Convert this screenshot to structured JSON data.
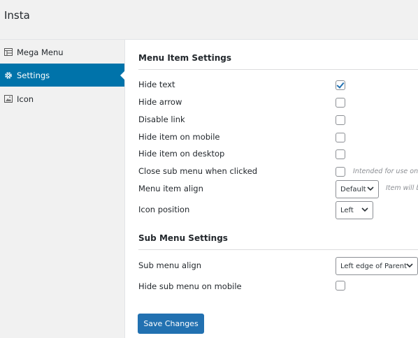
{
  "header": {
    "title": "Insta"
  },
  "sidebar": {
    "items": [
      {
        "label": "Mega Menu",
        "icon": "table-icon"
      },
      {
        "label": "Settings",
        "icon": "gear-icon",
        "active": true
      },
      {
        "label": "Icon",
        "icon": "image-icon"
      }
    ]
  },
  "menu_item_settings": {
    "title": "Menu Item Settings",
    "rows": [
      {
        "label": "Hide text",
        "checked": true
      },
      {
        "label": "Hide arrow",
        "checked": false
      },
      {
        "label": "Disable link",
        "checked": false
      },
      {
        "label": "Hide item on mobile",
        "checked": false
      },
      {
        "label": "Hide item on desktop",
        "checked": false
      },
      {
        "label": "Close sub menu when clicked",
        "checked": false,
        "hint": "Intended for use on an"
      },
      {
        "label": "Menu item align",
        "select": "Default",
        "hint": "Item will be"
      },
      {
        "label": "Icon position",
        "select": "Left"
      }
    ]
  },
  "sub_menu_settings": {
    "title": "Sub Menu Settings",
    "rows": [
      {
        "label": "Sub menu align",
        "select": "Left edge of Parent"
      },
      {
        "label": "Hide sub menu on mobile",
        "checked": false
      }
    ]
  },
  "actions": {
    "save_label": "Save Changes"
  },
  "colors": {
    "accent": "#0073aa",
    "button": "#2271b1"
  }
}
